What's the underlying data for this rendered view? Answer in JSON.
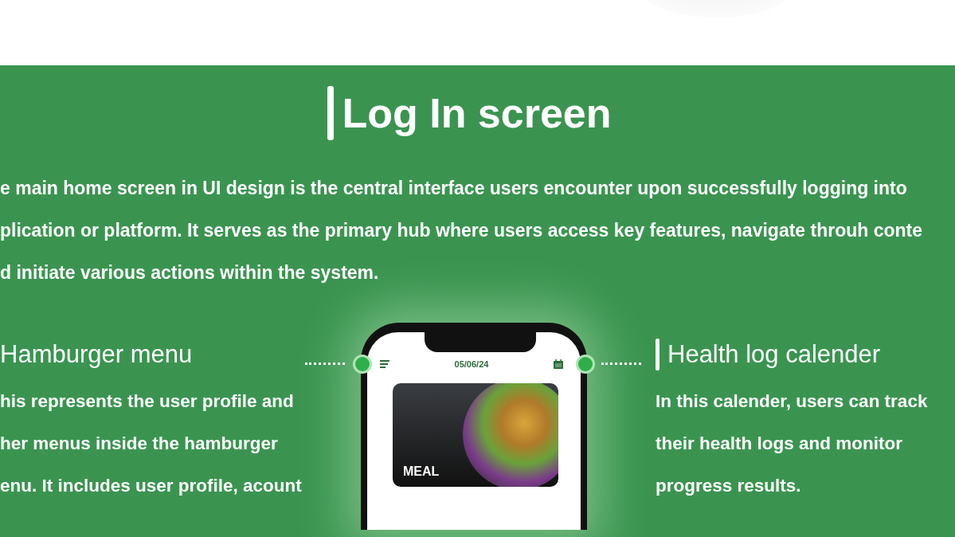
{
  "section": {
    "title": "Log In screen",
    "description_lines": [
      "e main  home screen in UI design is the central interface users encounter upon successfully logging into",
      "plication or platform. It serves as the primary hub where users access key features, navigate throuh conte",
      "d initiate various actions within the system."
    ]
  },
  "callouts": [
    {
      "heading": "Hamburger menu",
      "lines": [
        "his represents the user profile and",
        "her menus inside the hamburger",
        "enu. It includes user profile, acount"
      ]
    },
    {
      "heading": "Health log calender",
      "lines": [
        "In this calender, users can track",
        "their health logs and monitor",
        "progress results."
      ]
    }
  ],
  "phone": {
    "date": "05/06/24",
    "card_label": "MEAL"
  }
}
